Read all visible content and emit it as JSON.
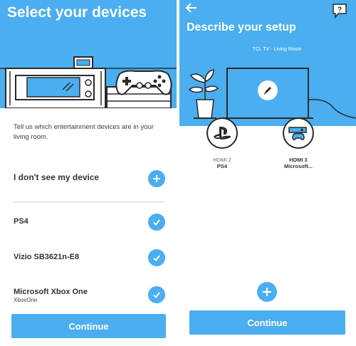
{
  "select_devices": {
    "title": "Select your devices",
    "intro": "Tell us which entertainment devices are in your living room.",
    "missing_device_label": "I don't see my device",
    "devices": [
      {
        "name": "PS4",
        "subtitle": ""
      },
      {
        "name": "Vizio SB3621n-E8",
        "subtitle": ""
      },
      {
        "name": "Microsoft Xbox One",
        "subtitle": "XboxOne"
      }
    ],
    "continue_label": "Continue"
  },
  "describe_setup": {
    "title": "Describe your setup",
    "tv_label": "TCL TV - Living Room",
    "help_glyph": "?",
    "ports": [
      {
        "port": "HDMI 2",
        "device": "PS4",
        "icon": "playstation-logo-icon"
      },
      {
        "port": "HDMI 3",
        "device": "Microsoft...",
        "icon": "xbox-console-icon"
      }
    ],
    "continue_label": "Continue"
  },
  "colors": {
    "accent": "#4aaef0",
    "line_art": "#2a2a2a",
    "text": "#333333"
  }
}
